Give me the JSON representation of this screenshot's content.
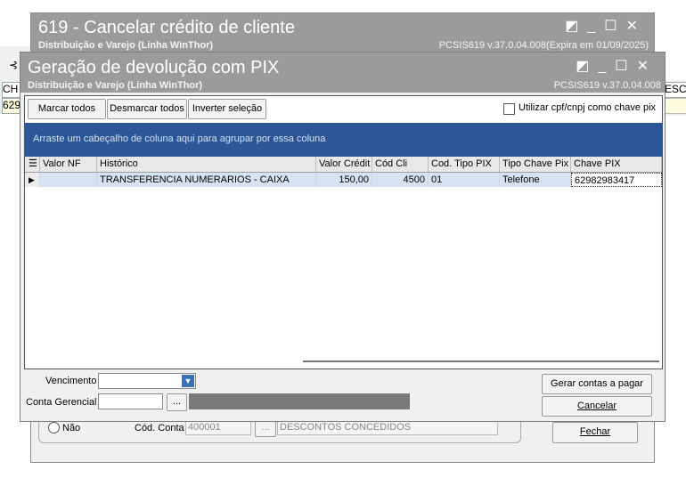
{
  "bg_window": {
    "title": "619 - Cancelar crédito de cliente",
    "subtitle": "Distribuição e Varejo (Linha WinThor)",
    "version": "PCSIS619  v.37.0.04.008(Expira em 01/09/2025)",
    "left_fragments": [
      "CH",
      "629"
    ],
    "right_fragment": "ESCO",
    "radio_nao": "Não",
    "cod_conta_label": "Cód. Conta",
    "cod_conta_value": "400001",
    "conta_desc": "DESCONTOS CONCEDIDOS",
    "fechar_label": "Fechar",
    "ellipsis": "..."
  },
  "window": {
    "title": "Geração de devolução com PIX",
    "subtitle": "Distribuição e Varejo (Linha WinThor)",
    "version": "PCSIS619  v.37.0.04.008"
  },
  "toolbar": {
    "marcar_todos": "Marcar todos",
    "desmarcar_todos": "Desmarcar todos",
    "inverter_selecao": "Inverter seleção",
    "cpf_checkbox_label": "Utilizar cpf/cnpj como chave pix",
    "cpf_checked": false
  },
  "grid": {
    "group_hint": "Arraste um cabeçalho de coluna aqui para agrupar por essa coluna",
    "columns": [
      "Valor NF",
      "Histórico",
      "Valor Crédit",
      "Cód Cli",
      "Cod. Tipo PIX",
      "Tipo Chave Pix",
      "Chave PIX"
    ],
    "rows": [
      {
        "valor_nf": "",
        "historico": "TRANSFERENCIA NUMERARIOS - CAIXA",
        "valor_credito": "150,00",
        "cod_cli": "4500",
        "cod_tipo_pix": "01",
        "tipo_chave_pix": "Telefone",
        "chave_pix": "62982983417"
      }
    ]
  },
  "footer": {
    "vencimento_label": "Vencimento",
    "vencimento_value": "",
    "conta_gerencial_label": "Conta Gerencial",
    "conta_gerencial_value": "",
    "ellipsis": "...",
    "gerar_label": "Gerar contas a pagar",
    "cancelar_label": "Cancelar"
  }
}
